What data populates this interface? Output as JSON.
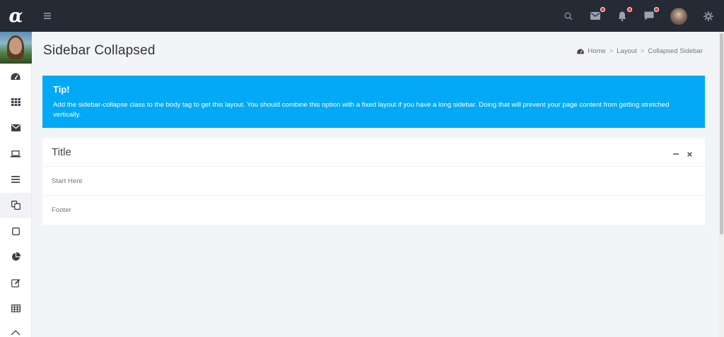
{
  "app": {
    "logo_text": "α"
  },
  "header": {
    "icons": [
      "search-icon",
      "envelope-icon",
      "bell-icon",
      "chat-icon",
      "user-avatar",
      "gear-icon"
    ]
  },
  "sidebar": {
    "items": [
      {
        "icon": "dashboard-icon"
      },
      {
        "icon": "apps-grid-icon"
      },
      {
        "icon": "envelope-icon"
      },
      {
        "icon": "laptop-icon"
      },
      {
        "icon": "menu-lines-icon"
      },
      {
        "icon": "copy-icon",
        "active": true
      },
      {
        "icon": "square-icon"
      },
      {
        "icon": "pie-chart-icon"
      },
      {
        "icon": "edit-icon"
      },
      {
        "icon": "table-icon"
      },
      {
        "icon": "home-icon"
      }
    ]
  },
  "page": {
    "title": "Sidebar Collapsed"
  },
  "breadcrumb": {
    "items": [
      "Home",
      "Layout",
      "Collapsed Sidebar"
    ],
    "separator": ">"
  },
  "tip": {
    "title": "Tip!",
    "text": "Add the sidebar-collapse class to the body tag to get this layout. You should combine this option with a fixed layout if you have a long sidebar. Doing that will prevent your page content from getting stretched vertically.",
    "color": "#03a9f4"
  },
  "box": {
    "title": "Title",
    "body": "Start Here",
    "footer": "Footer"
  },
  "colors": {
    "navbar": "#252a34",
    "notification_dot": "#ef3b3b",
    "background": "#f3f4f7"
  }
}
